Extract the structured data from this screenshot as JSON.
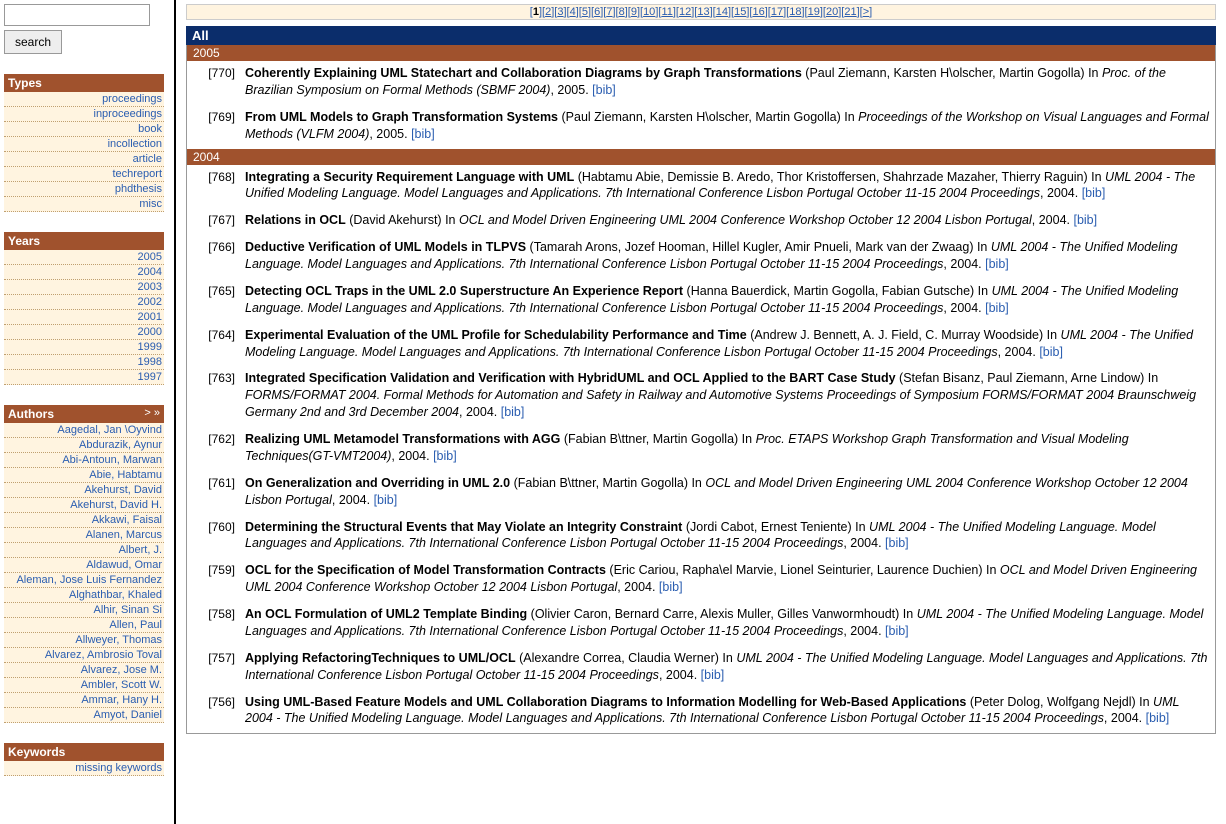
{
  "search": {
    "button": "search",
    "input_value": ""
  },
  "panels": {
    "types": {
      "title": "Types",
      "items": [
        "proceedings",
        "inproceedings",
        "book",
        "incollection",
        "article",
        "techreport",
        "phdthesis",
        "misc"
      ]
    },
    "years": {
      "title": "Years",
      "items": [
        "2005",
        "2004",
        "2003",
        "2002",
        "2001",
        "2000",
        "1999",
        "1998",
        "1997"
      ]
    },
    "authors": {
      "title": "Authors",
      "nav": "> »",
      "items": [
        "Aagedal, Jan \\Oyvind",
        "Abdurazik, Aynur",
        "Abi-Antoun, Marwan",
        "Abie, Habtamu",
        "Akehurst, David",
        "Akehurst, David H.",
        "Akkawi, Faisal",
        "Alanen, Marcus",
        "Albert, J.",
        "Aldawud, Omar",
        "Aleman, Jose Luis Fernandez",
        "Alghathbar, Khaled",
        "Alhir, Sinan Si",
        "Allen, Paul",
        "Allweyer, Thomas",
        "Alvarez, Ambrosio Toval",
        "Alvarez, Jose M.",
        "Ambler, Scott W.",
        "Ammar, Hany H.",
        "Amyot, Daniel"
      ]
    },
    "keywords": {
      "title": "Keywords",
      "items": [
        "missing keywords"
      ]
    }
  },
  "pagination": {
    "current": 1,
    "pages": [
      "1",
      "2",
      "3",
      "4",
      "5",
      "6",
      "7",
      "8",
      "9",
      "10",
      "11",
      "12",
      "13",
      "14",
      "15",
      "16",
      "17",
      "18",
      "19",
      "20",
      "21"
    ],
    "next": ">"
  },
  "header_all": "All",
  "bib_label": "[bib]",
  "groups": [
    {
      "year": "2005",
      "entries": [
        {
          "num": "[770]",
          "title": "Coherently Explaining UML Statechart and Collaboration Diagrams by Graph Transformations",
          "authors": "(Paul Ziemann, Karsten H\\olscher, Martin Gogolla)",
          "pre_venue": " In ",
          "venue": "Proc. of the Brazilian Symposium on Formal Methods (SBMF 2004)",
          "post_venue": ", 2005. ",
          "bib": true
        },
        {
          "num": "[769]",
          "title": "From UML Models to Graph Transformation Systems",
          "authors": "(Paul Ziemann, Karsten H\\olscher, Martin Gogolla)",
          "pre_venue": " In ",
          "venue": "Proceedings of the Workshop on Visual Languages and Formal Methods (VLFM 2004)",
          "post_venue": ", 2005. ",
          "bib": true
        }
      ]
    },
    {
      "year": "2004",
      "entries": [
        {
          "num": "[768]",
          "title": "Integrating a Security Requirement Language with UML",
          "authors": "(Habtamu Abie, Demissie B. Aredo, Thor Kristoffersen, Shahrzade Mazaher, Thierry Raguin)",
          "pre_venue": " In ",
          "venue": "UML 2004 - The Unified Modeling Language. Model Languages and Applications. 7th International Conference Lisbon Portugal October 11-15 2004 Proceedings",
          "post_venue": ", 2004. ",
          "bib": true
        },
        {
          "num": "[767]",
          "title": "Relations in OCL",
          "authors": "(David Akehurst)",
          "pre_venue": " In ",
          "venue": "OCL and Model Driven Engineering UML 2004 Conference Workshop October 12 2004 Lisbon Portugal",
          "post_venue": ", 2004. ",
          "bib": true
        },
        {
          "num": "[766]",
          "title": "Deductive Verification of UML Models in TLPVS",
          "authors": "(Tamarah Arons, Jozef Hooman, Hillel Kugler, Amir Pnueli, Mark van der Zwaag)",
          "pre_venue": " In ",
          "venue": "UML 2004 - The Unified Modeling Language. Model Languages and Applications. 7th International Conference Lisbon Portugal October 11-15 2004 Proceedings",
          "post_venue": ", 2004. ",
          "bib": true
        },
        {
          "num": "[765]",
          "title": "Detecting OCL Traps in the UML 2.0 Superstructure An Experience Report",
          "authors": "(Hanna Bauerdick, Martin Gogolla, Fabian Gutsche)",
          "pre_venue": " In ",
          "venue": "UML 2004 - The Unified Modeling Language. Model Languages and Applications. 7th International Conference Lisbon Portugal October 11-15 2004 Proceedings",
          "post_venue": ", 2004. ",
          "bib": true
        },
        {
          "num": "[764]",
          "title": "Experimental Evaluation of the UML Profile for Schedulability Performance and Time",
          "authors": "(Andrew J. Bennett, A. J. Field, C. Murray Woodside)",
          "pre_venue": " In ",
          "venue": "UML 2004 - The Unified Modeling Language. Model Languages and Applications. 7th International Conference Lisbon Portugal October 11-15 2004 Proceedings",
          "post_venue": ", 2004. ",
          "bib": true
        },
        {
          "num": "[763]",
          "title": "Integrated Specification Validation and Verification with HybridUML and OCL Applied to the BART Case Study",
          "authors": "(Stefan Bisanz, Paul Ziemann, Arne Lindow)",
          "pre_venue": " In ",
          "venue": "FORMS/FORMAT 2004. Formal Methods for Automation and Safety in Railway and Automotive Systems Proceedings of Symposium FORMS/FORMAT 2004 Braunschweig Germany 2nd and 3rd December 2004",
          "post_venue": ", 2004. ",
          "bib": true
        },
        {
          "num": "[762]",
          "title": "Realizing UML Metamodel Transformations with AGG",
          "authors": "(Fabian B\\ttner, Martin Gogolla)",
          "pre_venue": " In ",
          "venue": "Proc. ETAPS Workshop Graph Transformation and Visual Modeling Techniques(GT-VMT2004)",
          "post_venue": ", 2004. ",
          "bib": true
        },
        {
          "num": "[761]",
          "title": "On Generalization and Overriding in UML 2.0",
          "authors": "(Fabian B\\ttner, Martin Gogolla)",
          "pre_venue": " In ",
          "venue": "OCL and Model Driven Engineering UML 2004 Conference Workshop October 12 2004 Lisbon Portugal",
          "post_venue": ", 2004. ",
          "bib": true
        },
        {
          "num": "[760]",
          "title": "Determining the Structural Events that May Violate an Integrity Constraint",
          "authors": "(Jordi Cabot, Ernest Teniente)",
          "pre_venue": " In ",
          "venue": "UML 2004 - The Unified Modeling Language. Model Languages and Applications. 7th International Conference Lisbon Portugal October 11-15 2004 Proceedings",
          "post_venue": ", 2004. ",
          "bib": true
        },
        {
          "num": "[759]",
          "title": "OCL for the Specification of Model Transformation Contracts",
          "authors": "(Eric Cariou, Rapha\\el Marvie, Lionel Seinturier, Laurence Duchien)",
          "pre_venue": " In ",
          "venue": "OCL and Model Driven Engineering UML 2004 Conference Workshop October 12 2004 Lisbon Portugal",
          "post_venue": ", 2004. ",
          "bib": true
        },
        {
          "num": "[758]",
          "title": "An OCL Formulation of UML2 Template Binding",
          "authors": "(Olivier Caron, Bernard Carre, Alexis Muller, Gilles Vanwormhoudt)",
          "pre_venue": " In ",
          "venue": "UML 2004 - The Unified Modeling Language. Model Languages and Applications. 7th International Conference Lisbon Portugal October 11-15 2004 Proceedings",
          "post_venue": ", 2004. ",
          "bib": true
        },
        {
          "num": "[757]",
          "title": "Applying RefactoringTechniques to UML/OCL",
          "authors": "(Alexandre Correa, Claudia Werner)",
          "pre_venue": " In ",
          "venue": "UML 2004 - The Unified Modeling Language. Model Languages and Applications. 7th International Conference Lisbon Portugal October 11-15 2004 Proceedings",
          "post_venue": ", 2004. ",
          "bib": true
        },
        {
          "num": "[756]",
          "title": "Using UML-Based Feature Models and UML Collaboration Diagrams to Information Modelling for Web-Based Applications",
          "authors": "(Peter Dolog, Wolfgang Nejdl)",
          "pre_venue": " In ",
          "venue": "UML 2004 - The Unified Modeling Language. Model Languages and Applications. 7th International Conference Lisbon Portugal October 11-15 2004 Proceedings",
          "post_venue": ", 2004. ",
          "bib": true
        }
      ]
    }
  ]
}
